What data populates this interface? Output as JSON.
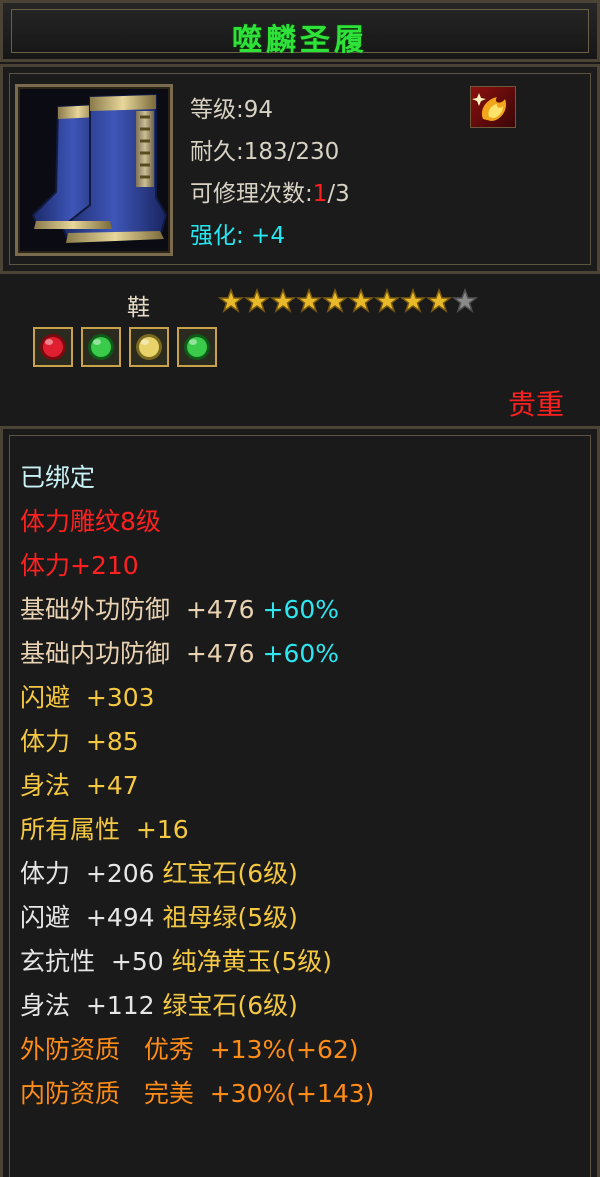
{
  "item": {
    "name": "噬麟圣履",
    "level": "等级:94",
    "durability_label": "耐久:",
    "durability_value": "183/230",
    "repair_label": "可修理次数:",
    "repair_used": "1",
    "repair_total": "/3",
    "enhance": "强化: +4",
    "type": "鞋",
    "star_count": 10,
    "star_filled": 9,
    "rarity": "贵重",
    "gems": [
      "red-gem-icon",
      "green-gem-icon",
      "yellow-gem-icon",
      "green-gem-icon"
    ]
  },
  "attributes": {
    "bound": "已绑定",
    "engraving": "体力雕纹8级",
    "engraving_bonus": "体力+210",
    "base_outer_label": "基础外功防御  +476 ",
    "base_outer_pct": "+60%",
    "base_inner_label": "基础内功防御  +476 ",
    "base_inner_pct": "+60%",
    "dodge": "闪避  +303",
    "stamina": "体力  +85",
    "agility": "身法  +47",
    "all_attr": "所有属性  +16",
    "gem1_stat": "体力  +206 ",
    "gem1_name": "红宝石(6级)",
    "gem2_stat": "闪避  +494 ",
    "gem2_name": "祖母绿(5级)",
    "gem3_stat": "玄抗性  +50 ",
    "gem3_name": "纯净黄玉(5级)",
    "gem4_stat": "身法  +112 ",
    "gem4_name": "绿宝石(6级)",
    "quality_outer": "外防资质   优秀  +13%(+62)",
    "quality_inner": "内防资质   完美  +30%(+143)"
  },
  "colors": {
    "title": "#2ee23a",
    "rarity": "#ff2020",
    "gem_text": "#f5c842",
    "quality": "#ff8c16",
    "bonus_pct": "#2ee6f0"
  }
}
